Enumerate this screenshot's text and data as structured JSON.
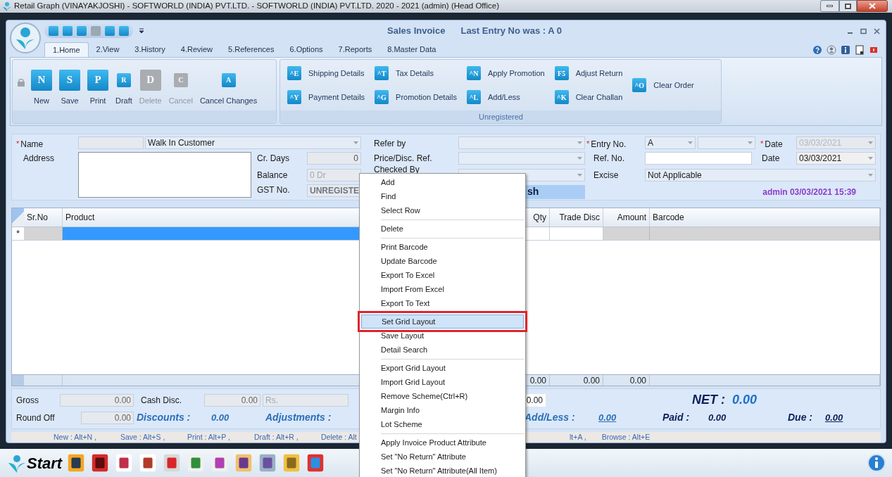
{
  "os_window": {
    "title": "Retail Graph (VINAYAKJOSHI) - SOFTWORLD (INDIA) PVT.LTD. - SOFTWORLD (INDIA) PVT.LTD.  2020 - 2021 (admin) (Head Office)"
  },
  "window": {
    "title": "Sales Invoice",
    "subtitle": "Last Entry No was : A 0"
  },
  "tabs": [
    {
      "label": "1.Home",
      "selected": true
    },
    {
      "label": "2.View",
      "selected": false
    },
    {
      "label": "3.History",
      "selected": false
    },
    {
      "label": "4.Review",
      "selected": false
    },
    {
      "label": "5.References",
      "selected": false
    },
    {
      "label": "6.Options",
      "selected": false
    },
    {
      "label": "7.Reports",
      "selected": false
    },
    {
      "label": "8.Master Data",
      "selected": false
    }
  ],
  "ribbon": {
    "main_buttons": [
      {
        "label": "New",
        "key": "N",
        "kind": "large",
        "disabled": false
      },
      {
        "label": "Save",
        "key": "S",
        "kind": "large",
        "disabled": false
      },
      {
        "label": "Print",
        "key": "P",
        "kind": "large",
        "disabled": false
      },
      {
        "label": "Draft",
        "key": "R",
        "kind": "small",
        "disabled": false
      },
      {
        "label": "Delete",
        "key": "D",
        "kind": "large",
        "disabled": true
      },
      {
        "label": "Cancel",
        "key": "C",
        "kind": "small",
        "disabled": true
      },
      {
        "label": "Cancel Changes",
        "key": "A",
        "kind": "small",
        "disabled": false
      }
    ],
    "detail_columns": [
      [
        {
          "label": "Shipping Details",
          "key": "^E"
        },
        {
          "label": "Payment Details",
          "key": "^Y"
        }
      ],
      [
        {
          "label": "Tax Details",
          "key": "^T"
        },
        {
          "label": "Promotion Details",
          "key": "^G"
        }
      ],
      [
        {
          "label": "Apply Promotion",
          "key": "^N"
        },
        {
          "label": "Add/Less",
          "key": "^L"
        }
      ],
      [
        {
          "label": "Adjust Return",
          "key": "F5"
        },
        {
          "label": "Clear Challan",
          "key": "^K"
        }
      ],
      [
        {
          "label": "Clear Order",
          "key": "^O"
        }
      ]
    ],
    "group_label": "Unregistered"
  },
  "form": {
    "name": {
      "label": "Name",
      "required": true,
      "value": "Walk In Customer"
    },
    "address": {
      "label": "Address"
    },
    "cr_days": {
      "label": "Cr. Days",
      "value": "0"
    },
    "balance": {
      "label": "Balance",
      "value": "0 Dr"
    },
    "gst_no": {
      "label": "GST No.",
      "value": "UNREGISTE"
    },
    "refer_by": {
      "label": "Refer by"
    },
    "price_disc_ref": {
      "label": "Price/Disc. Ref."
    },
    "checked_by": {
      "label": "Checked By"
    },
    "cash_label": "sh",
    "entry_no": {
      "label": "Entry No.",
      "required": true,
      "value": "A"
    },
    "entry_date": {
      "label": "Date",
      "required": true,
      "value": "03/03/2021",
      "disabled": true
    },
    "ref_no": {
      "label": "Ref. No."
    },
    "ref_date": {
      "label": "Date",
      "value": "03/03/2021",
      "disabled": false
    },
    "excise": {
      "label": "Excise",
      "value": "Not Applicable"
    },
    "stamp": "admin 03/03/2021 15:39"
  },
  "grid": {
    "new_row_marker": "*",
    "columns": [
      {
        "label": "Sr.No",
        "editable": false,
        "selected": false
      },
      {
        "label": "Product",
        "editable": true,
        "selected": true
      },
      {
        "label": "Qty",
        "editable": true,
        "selected": false,
        "total": "0.00"
      },
      {
        "label": "Trade Disc",
        "editable": true,
        "selected": false,
        "total": "0.00"
      },
      {
        "label": "Amount",
        "editable": false,
        "selected": false,
        "total": "0.00"
      },
      {
        "label": "Barcode",
        "editable": false,
        "selected": false
      }
    ]
  },
  "totals": {
    "gross": {
      "label": "Gross",
      "value": "0.00"
    },
    "cash_disc": {
      "label": "Cash Disc.",
      "value": "0.00",
      "unit": "Rs."
    },
    "amount_field": "0.00",
    "net": {
      "label": "NET :",
      "value": "0.00"
    },
    "round_off": {
      "label": "Round Off",
      "value": "0.00"
    },
    "discounts": {
      "label": "Discounts :",
      "value": "0.00"
    },
    "adjustments": {
      "label": "Adjustments :"
    },
    "add_less": {
      "label": "Add/Less :",
      "value": "0.00"
    },
    "paid": {
      "label": "Paid :",
      "value": "0.00"
    },
    "due": {
      "label": "Due :",
      "value": "0.00"
    }
  },
  "shortcuts": [
    "New : Alt+N ,",
    "Save : Alt+S ,",
    "Print : Alt+P ,",
    "Draft : Alt+R ,",
    "Delete : Alt"
  ],
  "shortcuts_right": [
    "lt+A ,",
    "Browse : Alt+E"
  ],
  "taskbar": {
    "start_label": "Start"
  },
  "context_menu": {
    "groups": [
      [
        {
          "label": "Add",
          "selected": false
        },
        {
          "label": "Find",
          "selected": false
        },
        {
          "label": "Select Row",
          "selected": false
        }
      ],
      [
        {
          "label": "Delete",
          "selected": false
        }
      ],
      [
        {
          "label": "Print Barcode",
          "selected": false
        },
        {
          "label": "Update Barcode",
          "selected": false
        },
        {
          "label": "Export To Excel",
          "selected": false
        },
        {
          "label": "Import From Excel",
          "selected": false
        },
        {
          "label": "Export To Text",
          "selected": false
        }
      ],
      [
        {
          "label": "Set Grid Layout",
          "selected": true
        },
        {
          "label": "Save Layout",
          "selected": false
        },
        {
          "label": "Detail Search",
          "selected": false
        }
      ],
      [
        {
          "label": "Export Grid Layout",
          "selected": false
        },
        {
          "label": "Import Grid Layout",
          "selected": false
        },
        {
          "label": "Remove Scheme(Ctrl+R)",
          "selected": false
        },
        {
          "label": "Margin Info",
          "selected": false
        },
        {
          "label": "Lot Scheme",
          "selected": false
        }
      ],
      [
        {
          "label": "Apply Invoice Product Attribute",
          "selected": false
        },
        {
          "label": "Set \"No Return\" Attribute",
          "selected": false
        },
        {
          "label": "Set \"No Return\" Attribute(All Item)",
          "selected": false
        }
      ]
    ]
  }
}
